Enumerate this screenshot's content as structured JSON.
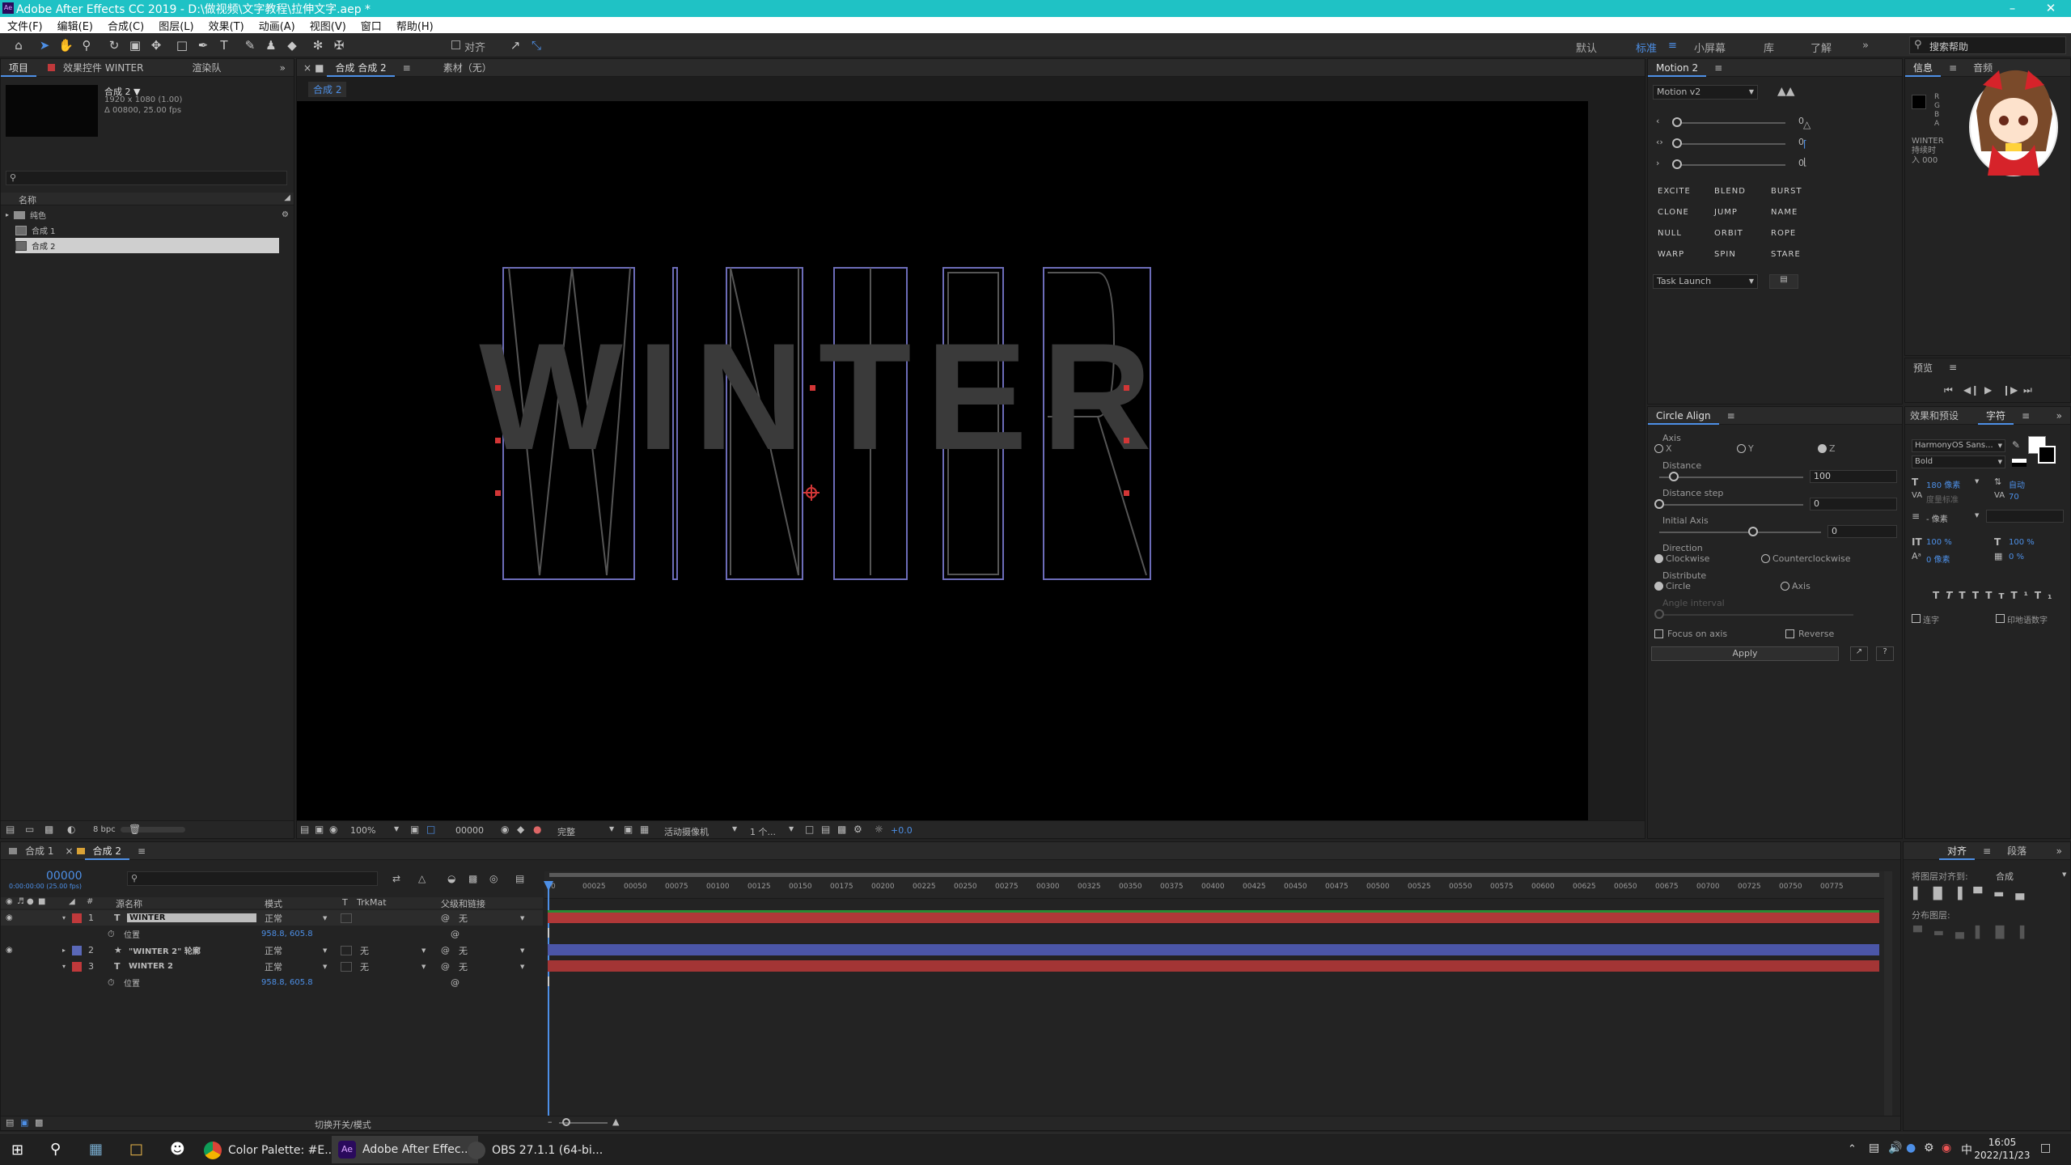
{
  "window": {
    "title": "Adobe After Effects CC 2019 - D:\\做视频\\文字教程\\拉伸文字.aep *"
  },
  "menu": [
    "文件(F)",
    "编辑(E)",
    "合成(C)",
    "图层(L)",
    "效果(T)",
    "动画(A)",
    "视图(V)",
    "窗口",
    "帮助(H)"
  ],
  "toolbar": {
    "snap_label": "对齐",
    "search_placeholder": "搜索帮助"
  },
  "workspaces": [
    "默认",
    "标准",
    "小屏幕",
    "库",
    "了解"
  ],
  "workspace_active": "标准",
  "project": {
    "tab_project": "项目",
    "tab_effects": "效果控件 WINTER",
    "tab_render": "渲染队",
    "comp_name": "合成 2 ▼",
    "comp_size": "1920 x 1080 (1.00)",
    "comp_dur": "Δ 00800, 25.00 fps",
    "col_name": "名称",
    "items": [
      "纯色",
      "合成 1",
      "合成 2"
    ],
    "bpc": "8 bpc"
  },
  "composition": {
    "tab": "合成 合成 2",
    "footage_tab": "素材（无）",
    "breadcrumb": "合成 2",
    "text": "WINTER",
    "zoom": "100%",
    "timecode": "00000",
    "quality": "完整",
    "camera": "活动摄像机",
    "views": "1 个...",
    "exposure": "+0.0"
  },
  "motion": {
    "tab": "Motion 2",
    "preset": "Motion v2",
    "sliders": [
      "0",
      "0",
      "0"
    ],
    "buttons": [
      "EXCITE",
      "BLEND",
      "BURST",
      "CLONE",
      "JUMP",
      "NAME",
      "NULL",
      "ORBIT",
      "ROPE",
      "WARP",
      "SPIN",
      "STARE"
    ],
    "task": "Task Launch"
  },
  "circle_align": {
    "tab": "Circle Align",
    "axis_label": "Axis",
    "axis_options": [
      "X",
      "Y",
      "Z"
    ],
    "distance_label": "Distance",
    "distance_value": "100",
    "step_label": "Distance step",
    "step_value": "0",
    "initial_label": "Initial Axis",
    "initial_value": "0",
    "direction_label": "Direction",
    "dir_options": [
      "Clockwise",
      "Counterclockwise"
    ],
    "distribute_label": "Distribute",
    "dist_options": [
      "Circle",
      "Axis"
    ],
    "angle_label": "Angle interval",
    "focus": "Focus on axis",
    "reverse": "Reverse",
    "apply": "Apply"
  },
  "info": {
    "tab_info": "信息",
    "tab_audio": "音频",
    "info_lines": [
      "WINTER",
      "持续时",
      "入 000"
    ],
    "rgba": [
      "R",
      "G",
      "B",
      "A"
    ]
  },
  "preview": {
    "tab": "预览"
  },
  "character": {
    "tab_effects": "效果和预设",
    "tab_char": "字符",
    "font": "HarmonyOS Sans...",
    "weight": "Bold",
    "size": "180 像素",
    "leading": "自动",
    "kerning": "度量标准",
    "tracking": "70",
    "stroke": "- 像素",
    "vscale": "100 %",
    "hscale": "100 %",
    "baseline": "0 像素",
    "tsume": "0 %",
    "ligature": "连字",
    "hindi": "印地语数字"
  },
  "align": {
    "tab_align": "对齐",
    "tab_para": "段落",
    "align_to": "将图层对齐到:",
    "align_target": "合成",
    "distribute": "分布图层:"
  },
  "timeline": {
    "tabs": [
      "合成 1",
      "合成 2"
    ],
    "timecode": "00000",
    "timecode_sub": "0:00:00:00 (25.00 fps)",
    "cols": [
      "源名称",
      "模式",
      "T",
      "TrkMat",
      "父级和链接"
    ],
    "layers": [
      {
        "num": "1",
        "type": "T",
        "name": "WINTER",
        "mode": "正常",
        "parent": "无",
        "color": "#c0393b"
      },
      {
        "num": "",
        "type": "",
        "name": "位置",
        "mode": "",
        "parent": "",
        "value": "958.8, 605.8",
        "color": ""
      },
      {
        "num": "2",
        "type": "★",
        "name": "\"WINTER 2\" 轮廓",
        "mode": "正常",
        "parent": "无",
        "color": "#5a68b8"
      },
      {
        "num": "3",
        "type": "T",
        "name": "WINTER 2",
        "mode": "正常",
        "parent": "无",
        "color": "#c0393b"
      },
      {
        "num": "",
        "type": "",
        "name": "位置",
        "mode": "",
        "parent": "",
        "value": "958.8, 605.8",
        "color": ""
      }
    ],
    "ruler": [
      "00025",
      "00050",
      "00075",
      "00100",
      "00125",
      "00150",
      "00175",
      "00200",
      "00225",
      "00250",
      "00275",
      "00300",
      "00325",
      "00350",
      "00375",
      "00400",
      "00425",
      "00450",
      "00475",
      "00500",
      "00525",
      "00550",
      "00575",
      "00600",
      "00625",
      "00650",
      "00675",
      "00700",
      "00725",
      "00750",
      "00775"
    ],
    "ruler_start": "0",
    "toggle": "切换开关/模式"
  },
  "taskbar": {
    "apps": [
      "Color Palette: #E...",
      "Adobe After Effec...",
      "OBS 27.1.1 (64-bi..."
    ],
    "time": "16:05",
    "date": "2022/11/23"
  },
  "colors": {
    "accent": "#4d8fe6",
    "title": "#1fc2c5",
    "red_layer": "#c0393b",
    "blue_layer": "#5a68b8",
    "outline": "#6c6cb8"
  }
}
